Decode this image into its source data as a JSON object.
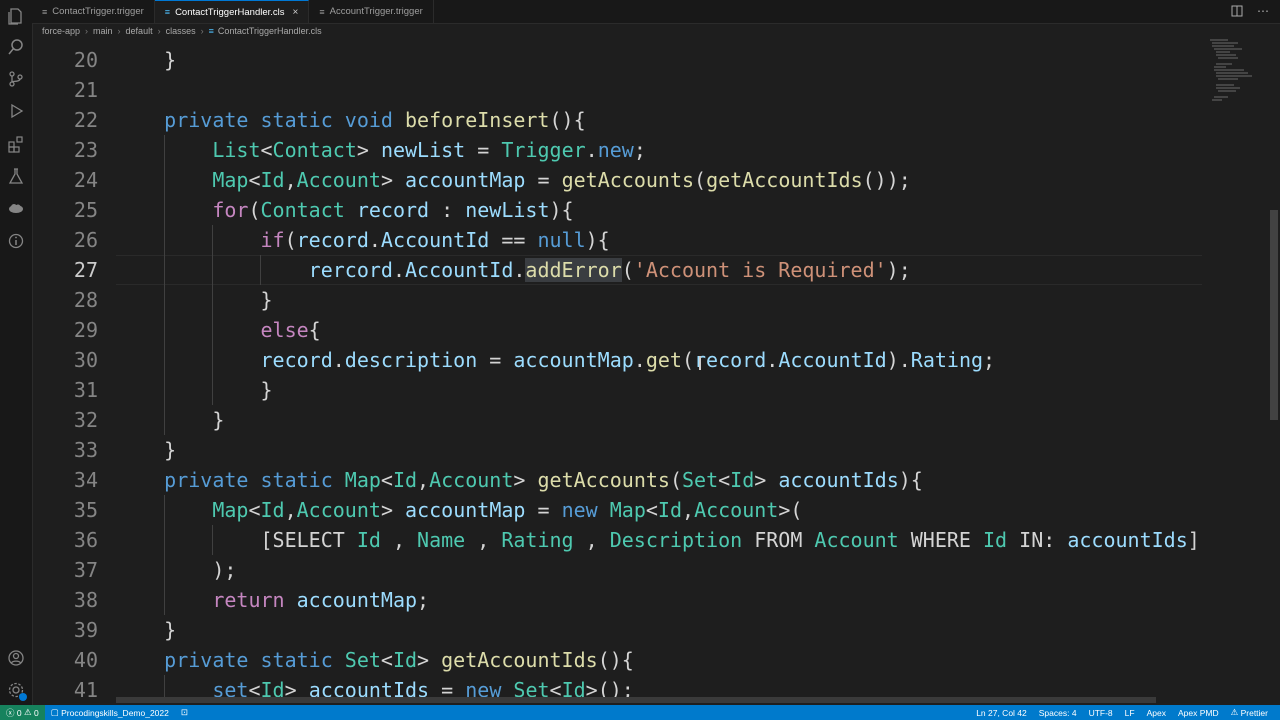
{
  "tabs": [
    {
      "label": "ContactTrigger.trigger",
      "active": false
    },
    {
      "label": "ContactTriggerHandler.cls",
      "active": true
    },
    {
      "label": "AccountTrigger.trigger",
      "active": false
    }
  ],
  "tab_close": "×",
  "breadcrumb": [
    "force-app",
    "main",
    "default",
    "classes",
    "ContactTriggerHandler.cls"
  ],
  "code_lines": [
    {
      "n": "20",
      "tokens": [
        [
          "pun",
          "    }"
        ]
      ]
    },
    {
      "n": "21",
      "tokens": []
    },
    {
      "n": "22",
      "tokens": [
        [
          "kw",
          "    private static void "
        ],
        [
          "fn",
          "beforeInsert"
        ],
        [
          "pun",
          "(){"
        ]
      ]
    },
    {
      "n": "23",
      "tokens": [
        [
          "ty",
          "        List"
        ],
        [
          "pun",
          "<"
        ],
        [
          "ty",
          "Contact"
        ],
        [
          "pun",
          "> "
        ],
        [
          "var",
          "newList"
        ],
        [
          "pun",
          " = "
        ],
        [
          "ty",
          "Trigger"
        ],
        [
          "pun",
          "."
        ],
        [
          "kw",
          "new"
        ],
        [
          "pun",
          ";"
        ]
      ]
    },
    {
      "n": "24",
      "tokens": [
        [
          "ty",
          "        Map"
        ],
        [
          "pun",
          "<"
        ],
        [
          "ty",
          "Id"
        ],
        [
          "pun",
          ","
        ],
        [
          "ty",
          "Account"
        ],
        [
          "pun",
          "> "
        ],
        [
          "var",
          "accountMap"
        ],
        [
          "pun",
          " = "
        ],
        [
          "fn",
          "getAccounts"
        ],
        [
          "pun",
          "("
        ],
        [
          "fn",
          "getAccountIds"
        ],
        [
          "pun",
          "());"
        ]
      ]
    },
    {
      "n": "25",
      "tokens": [
        [
          "ctl",
          "        for"
        ],
        [
          "pun",
          "("
        ],
        [
          "ty",
          "Contact"
        ],
        [
          "pun",
          " "
        ],
        [
          "var",
          "record"
        ],
        [
          "pun",
          " : "
        ],
        [
          "var",
          "newList"
        ],
        [
          "pun",
          "){"
        ]
      ]
    },
    {
      "n": "26",
      "tokens": [
        [
          "ctl",
          "            if"
        ],
        [
          "pun",
          "("
        ],
        [
          "var",
          "record"
        ],
        [
          "pun",
          "."
        ],
        [
          "var",
          "AccountId"
        ],
        [
          "pun",
          " == "
        ],
        [
          "kw",
          "null"
        ],
        [
          "pun",
          "){"
        ]
      ]
    },
    {
      "n": "27",
      "tokens": [
        [
          "var",
          "                rercord"
        ],
        [
          "pun",
          "."
        ],
        [
          "var",
          "AccountId"
        ],
        [
          "pun",
          "."
        ],
        [
          "fn",
          "addError"
        ],
        [
          "pun",
          "("
        ],
        [
          "str",
          "'Account is Required'"
        ],
        [
          "pun",
          ");"
        ]
      ]
    },
    {
      "n": "28",
      "tokens": [
        [
          "pun",
          "            }"
        ]
      ]
    },
    {
      "n": "29",
      "tokens": [
        [
          "ctl",
          "            else"
        ],
        [
          "pun",
          "{"
        ]
      ]
    },
    {
      "n": "30",
      "tokens": [
        [
          "var",
          "            record"
        ],
        [
          "pun",
          "."
        ],
        [
          "var",
          "description"
        ],
        [
          "pun",
          " = "
        ],
        [
          "var",
          "accountMap"
        ],
        [
          "pun",
          "."
        ],
        [
          "fn",
          "get"
        ],
        [
          "pun",
          "("
        ],
        [
          "var",
          "record"
        ],
        [
          "pun",
          "."
        ],
        [
          "var",
          "AccountId"
        ],
        [
          "pun",
          ")."
        ],
        [
          "var",
          "Rating"
        ],
        [
          "pun",
          ";"
        ]
      ]
    },
    {
      "n": "31",
      "tokens": [
        [
          "pun",
          "            }"
        ]
      ]
    },
    {
      "n": "32",
      "tokens": [
        [
          "pun",
          "        }"
        ]
      ]
    },
    {
      "n": "33",
      "tokens": [
        [
          "pun",
          "    }"
        ]
      ]
    },
    {
      "n": "34",
      "tokens": [
        [
          "kw",
          "    private static "
        ],
        [
          "ty",
          "Map"
        ],
        [
          "pun",
          "<"
        ],
        [
          "ty",
          "Id"
        ],
        [
          "pun",
          ","
        ],
        [
          "ty",
          "Account"
        ],
        [
          "pun",
          "> "
        ],
        [
          "fn",
          "getAccounts"
        ],
        [
          "pun",
          "("
        ],
        [
          "ty",
          "Set"
        ],
        [
          "pun",
          "<"
        ],
        [
          "ty",
          "Id"
        ],
        [
          "pun",
          "> "
        ],
        [
          "var",
          "accountIds"
        ],
        [
          "pun",
          "){"
        ]
      ]
    },
    {
      "n": "35",
      "tokens": [
        [
          "ty",
          "        Map"
        ],
        [
          "pun",
          "<"
        ],
        [
          "ty",
          "Id"
        ],
        [
          "pun",
          ","
        ],
        [
          "ty",
          "Account"
        ],
        [
          "pun",
          "> "
        ],
        [
          "var",
          "accountMap"
        ],
        [
          "pun",
          " = "
        ],
        [
          "kw",
          "new "
        ],
        [
          "ty",
          "Map"
        ],
        [
          "pun",
          "<"
        ],
        [
          "ty",
          "Id"
        ],
        [
          "pun",
          ","
        ],
        [
          "ty",
          "Account"
        ],
        [
          "pun",
          ">("
        ]
      ]
    },
    {
      "n": "36",
      "tokens": [
        [
          "pun",
          "            [SELECT "
        ],
        [
          "ty",
          "Id"
        ],
        [
          "pun",
          " , "
        ],
        [
          "ty",
          "Name"
        ],
        [
          "pun",
          " , "
        ],
        [
          "ty",
          "Rating"
        ],
        [
          "pun",
          " , "
        ],
        [
          "ty",
          "Description"
        ],
        [
          "pun",
          " FROM "
        ],
        [
          "ty",
          "Account"
        ],
        [
          "pun",
          " WHERE "
        ],
        [
          "ty",
          "Id"
        ],
        [
          "pun",
          " IN: "
        ],
        [
          "var",
          "accountIds"
        ],
        [
          "pun",
          "]"
        ]
      ]
    },
    {
      "n": "37",
      "tokens": [
        [
          "pun",
          "        );"
        ]
      ]
    },
    {
      "n": "38",
      "tokens": [
        [
          "ctl",
          "        return "
        ],
        [
          "var",
          "accountMap"
        ],
        [
          "pun",
          ";"
        ]
      ]
    },
    {
      "n": "39",
      "tokens": [
        [
          "pun",
          "    }"
        ]
      ]
    },
    {
      "n": "40",
      "tokens": [
        [
          "kw",
          "    private static "
        ],
        [
          "ty",
          "Set"
        ],
        [
          "pun",
          "<"
        ],
        [
          "ty",
          "Id"
        ],
        [
          "pun",
          "> "
        ],
        [
          "fn",
          "getAccountIds"
        ],
        [
          "pun",
          "(){"
        ]
      ]
    },
    {
      "n": "41",
      "tokens": [
        [
          "kw",
          "        set"
        ],
        [
          "pun",
          "<"
        ],
        [
          "ty",
          "Id"
        ],
        [
          "pun",
          "> "
        ],
        [
          "var",
          "accountIds"
        ],
        [
          "pun",
          " = "
        ],
        [
          "kw",
          "new "
        ],
        [
          "ty",
          "Set"
        ],
        [
          "pun",
          "<"
        ],
        [
          "ty",
          "Id"
        ],
        [
          "pun",
          ">();"
        ]
      ]
    }
  ],
  "current_line": "27",
  "status": {
    "errors": "0",
    "warnings": "0",
    "org": "Procodingskills_Demo_2022",
    "position": "Ln 27, Col 42",
    "spaces": "Spaces: 4",
    "encoding": "UTF-8",
    "eol": "LF",
    "language": "Apex",
    "pmd": "Apex PMD",
    "prettier": "Prettier"
  },
  "colors": {
    "keyword": "#569cd6",
    "control": "#c586c0",
    "type": "#4ec9b0",
    "function": "#dcdcaa",
    "variable": "#9cdcfe",
    "string": "#ce9178",
    "statusbar": "#007acc"
  }
}
